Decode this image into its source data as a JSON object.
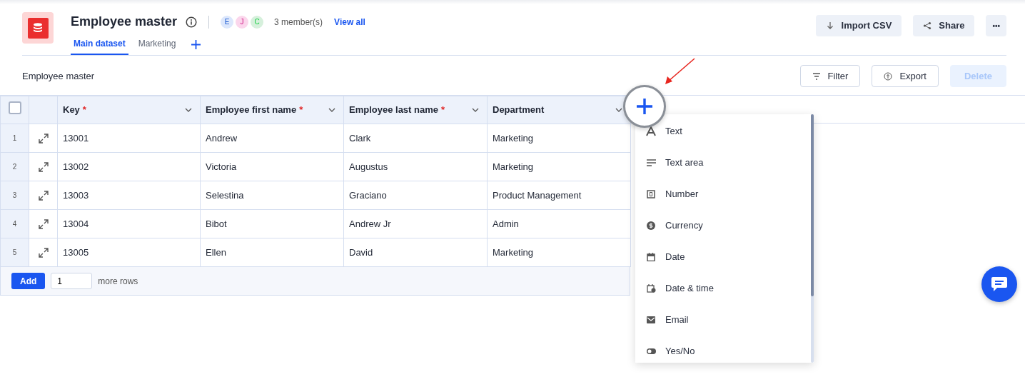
{
  "header": {
    "title": "Employee master",
    "members": [
      {
        "initial": "E",
        "color": "#dce7fc"
      },
      {
        "initial": "J",
        "color": "#fbd6ec"
      },
      {
        "initial": "C",
        "color": "#d6f0dc"
      }
    ],
    "members_count": "3 member(s)",
    "view_all": "View all",
    "tabs": [
      {
        "label": "Main dataset",
        "selected": true
      },
      {
        "label": "Marketing",
        "selected": false
      }
    ],
    "actions": [
      {
        "kind": "import",
        "label": "Import CSV"
      },
      {
        "kind": "share",
        "label": "Share"
      },
      {
        "kind": "more",
        "label": "•••"
      }
    ]
  },
  "toolbar": {
    "title": "Employee master",
    "buttons": [
      {
        "kind": "filter",
        "label": "Filter",
        "disabled": false
      },
      {
        "kind": "export",
        "label": "Export",
        "disabled": false
      },
      {
        "kind": "none",
        "label": "Delete",
        "disabled": true
      }
    ]
  },
  "table": {
    "select_all_checked": false,
    "columns": [
      {
        "label": "Key",
        "required_mark": "*"
      },
      {
        "label": "Employee first name",
        "required_mark": "*"
      },
      {
        "label": "Employee last name",
        "required_mark": "*"
      },
      {
        "label": "Department"
      }
    ],
    "rows": [
      {
        "number": "1",
        "cells": [
          "13001",
          "Andrew",
          "Clark",
          "Marketing"
        ]
      },
      {
        "number": "2",
        "cells": [
          "13002",
          "Victoria",
          "Augustus",
          "Marketing"
        ]
      },
      {
        "number": "3",
        "cells": [
          "13003",
          "Selestina",
          "Graciano",
          "Product Management"
        ]
      },
      {
        "number": "4",
        "cells": [
          "13004",
          "Bibot",
          "Andrew Jr",
          "Admin"
        ]
      },
      {
        "number": "5",
        "cells": [
          "13005",
          "Ellen",
          "David",
          "Marketing"
        ]
      }
    ],
    "footer": {
      "button": "Add",
      "count": "1",
      "suffix": "more rows"
    }
  },
  "field_type_menu": [
    {
      "kind": "text",
      "label": "Text"
    },
    {
      "kind": "textarea",
      "label": "Text area"
    },
    {
      "kind": "number",
      "label": "Number"
    },
    {
      "kind": "currency",
      "label": "Currency"
    },
    {
      "kind": "date",
      "label": "Date"
    },
    {
      "kind": "datetime",
      "label": "Date & time"
    },
    {
      "kind": "email",
      "label": "Email"
    },
    {
      "kind": "yesno",
      "label": "Yes/No"
    }
  ]
}
